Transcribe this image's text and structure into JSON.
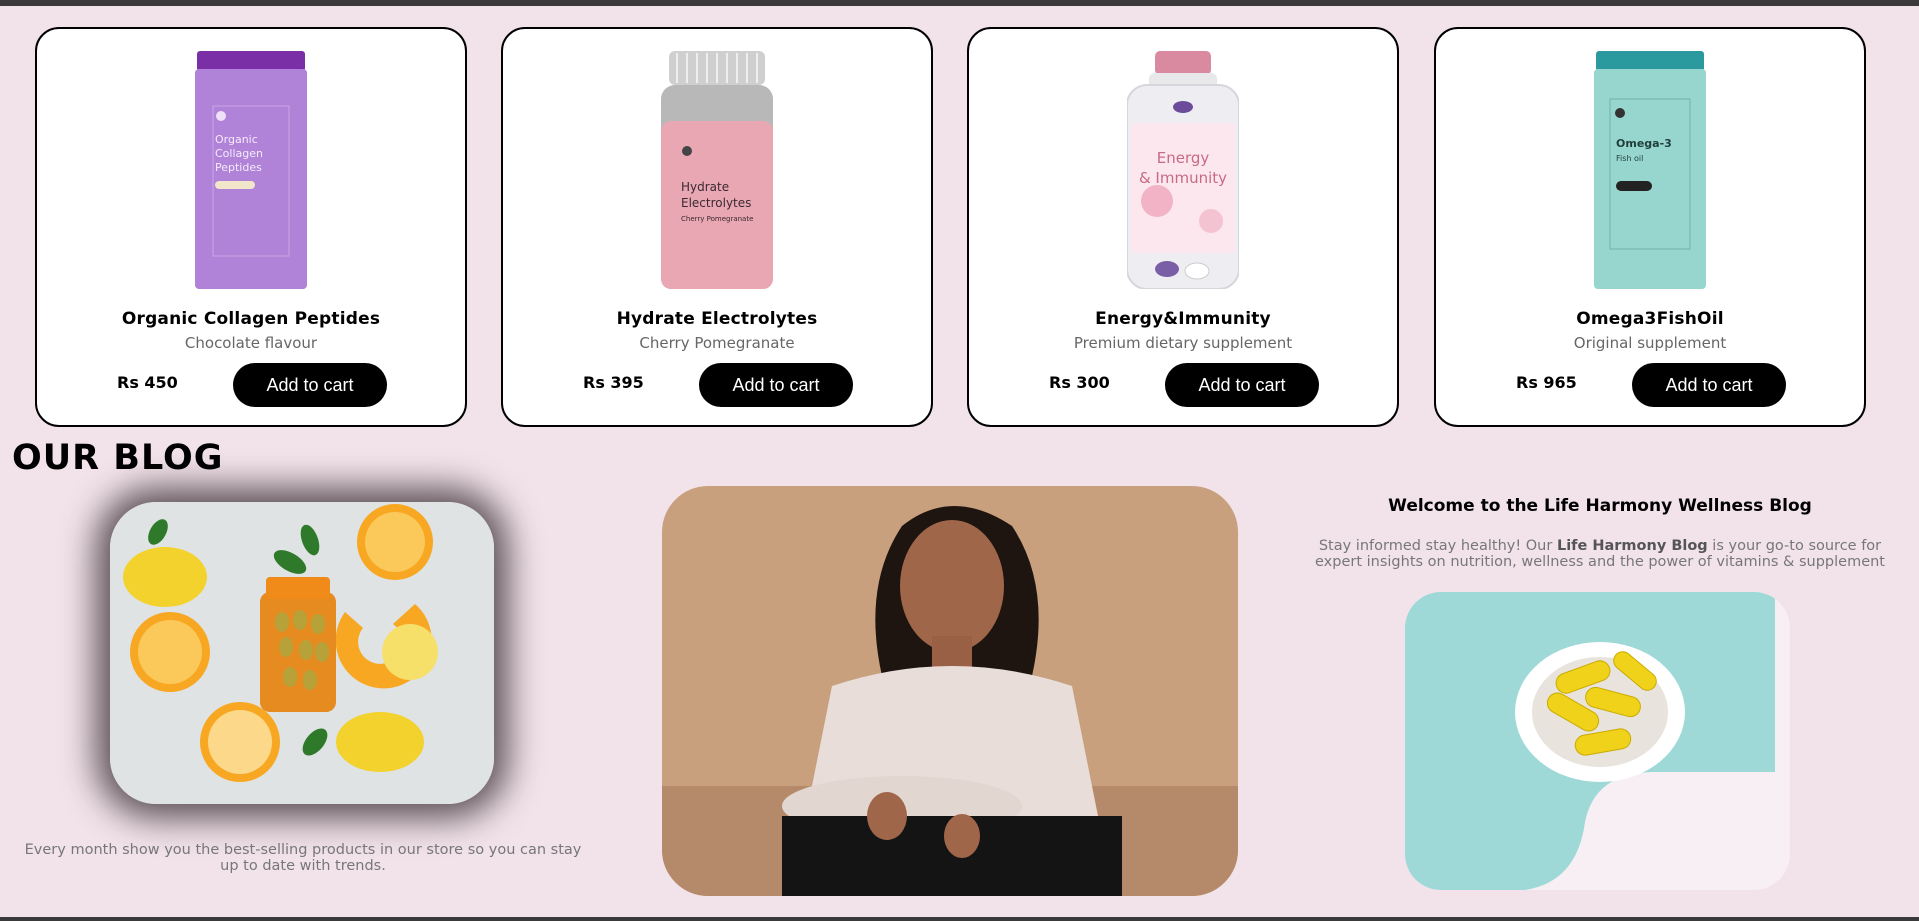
{
  "products": [
    {
      "name": "Organic Collagen Peptides",
      "desc": "Chocolate flavour",
      "price": "Rs 450",
      "button": "Add to cart",
      "image": "collagen-jar-image",
      "color": "#a86fd1"
    },
    {
      "name": "Hydrate Electrolytes",
      "desc": "Cherry Pomegranate",
      "price": "Rs 395",
      "button": "Add to cart",
      "image": "electrolytes-bottle-image",
      "color": "#e9a7b3"
    },
    {
      "name": "Energy&Immunity",
      "desc": "Premium dietary supplement",
      "price": "Rs 300",
      "button": "Add to cart",
      "image": "energy-immunity-bottle-image",
      "color": "#f2c6d2"
    },
    {
      "name": "Omega3FishOil",
      "desc": "Original supplement",
      "price": "Rs 965",
      "button": "Add to cart",
      "image": "omega3-jar-image",
      "color": "#8fd3cb"
    }
  ],
  "product_labels": {
    "collagen": [
      "Organic",
      "Collagen",
      "Peptides"
    ],
    "electrolytes": [
      "Hydrate",
      "Electrolytes",
      "Cherry Pomegranate"
    ],
    "energy": [
      "Energy",
      "& Immunity"
    ],
    "omega": [
      "Omega-3",
      "Fish oil"
    ]
  },
  "blog": {
    "title": "OUR BLOG",
    "caption": "Every month show you the best-selling products in our store so you can stay up to date with trends.",
    "heading": "Welcome to the Life Harmony Wellness Blog",
    "text_before": "Stay informed stay healthy! Our ",
    "text_bold": "Life Harmony Blog",
    "text_after": " is your go-to source for expert insights on nutrition, wellness and the power of vitamins & supplement"
  },
  "colors": {
    "background": "#f2e3ea",
    "button": "#000000",
    "card": "#ffffff"
  }
}
